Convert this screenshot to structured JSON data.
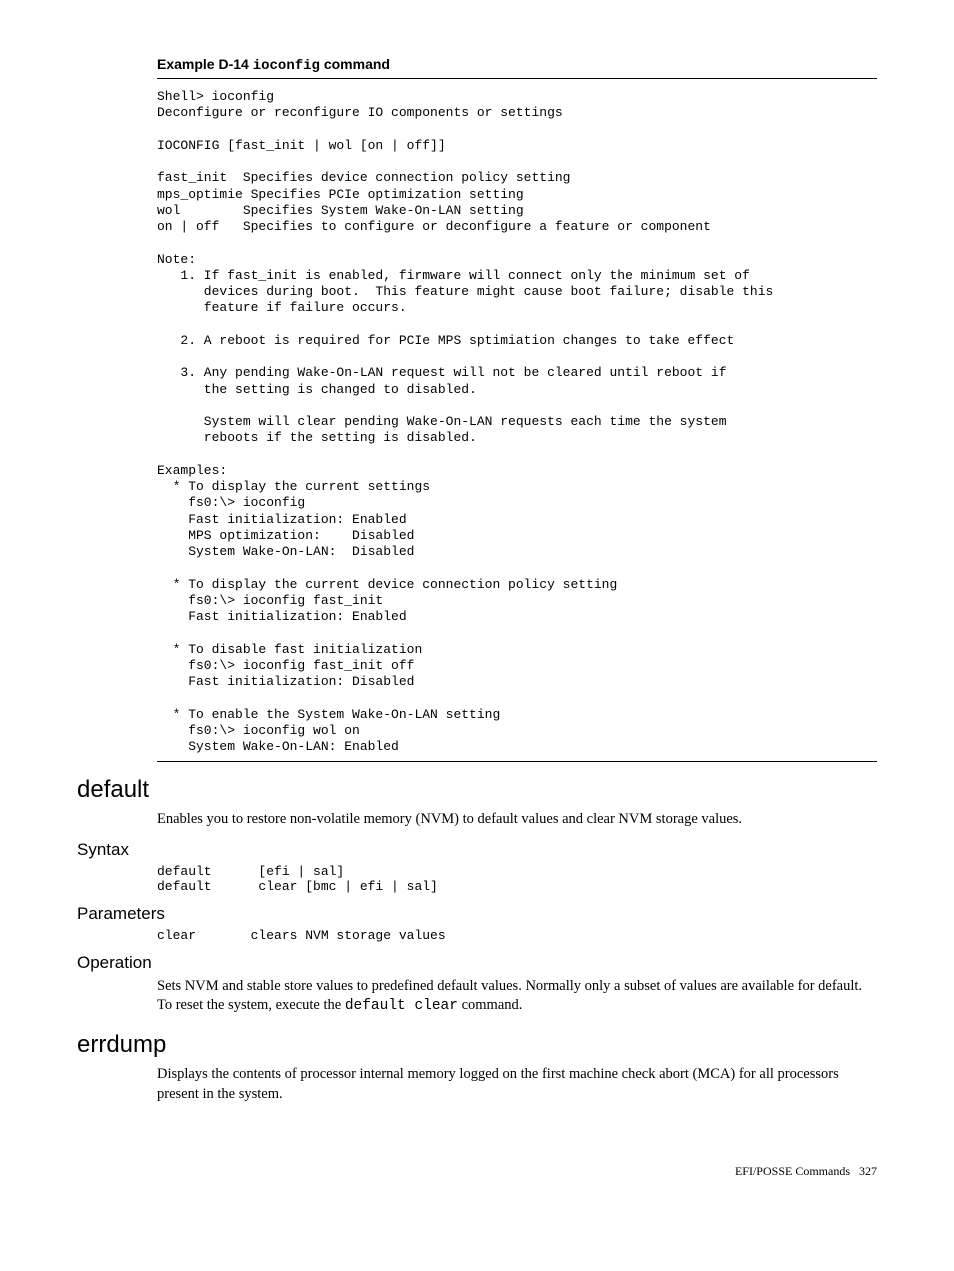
{
  "example": {
    "label_prefix": "Example D-14",
    "label_code": "ioconfig",
    "label_suffix": "command",
    "code": "Shell> ioconfig\nDeconfigure or reconfigure IO components or settings\n\nIOCONFIG [fast_init | wol [on | off]]\n\nfast_init  Specifies device connection policy setting\nmps_optimie Specifies PCIe optimization setting\nwol        Specifies System Wake-On-LAN setting\non | off   Specifies to configure or deconfigure a feature or component\n\nNote:\n   1. If fast_init is enabled, firmware will connect only the minimum set of\n      devices during boot.  This feature might cause boot failure; disable this\n      feature if failure occurs.\n\n   2. A reboot is required for PCIe MPS sptimiation changes to take effect\n\n   3. Any pending Wake-On-LAN request will not be cleared until reboot if\n      the setting is changed to disabled.\n\n      System will clear pending Wake-On-LAN requests each time the system\n      reboots if the setting is disabled.\n\nExamples:\n  * To display the current settings\n    fs0:\\> ioconfig\n    Fast initialization: Enabled\n    MPS optimization:    Disabled\n    System Wake-On-LAN:  Disabled\n\n  * To display the current device connection policy setting\n    fs0:\\> ioconfig fast_init\n    Fast initialization: Enabled\n\n  * To disable fast initialization\n    fs0:\\> ioconfig fast_init off\n    Fast initialization: Disabled\n\n  * To enable the System Wake-On-LAN setting\n    fs0:\\> ioconfig wol on\n    System Wake-On-LAN: Enabled"
  },
  "sections": {
    "default": {
      "heading": "default",
      "intro": "Enables you to restore non-volatile memory (NVM) to default values and clear NVM storage values.",
      "syntax_heading": "Syntax",
      "syntax_code": "default      [efi | sal]\ndefault      clear [bmc | efi | sal]",
      "parameters_heading": "Parameters",
      "parameters_code": "clear       clears NVM storage values",
      "operation_heading": "Operation",
      "operation_text_1": "Sets NVM and stable store values to predefined default values. Normally only a subset of values are available for default. To reset the system, execute the ",
      "operation_code": "default clear",
      "operation_text_2": " command."
    },
    "errdump": {
      "heading": "errdump",
      "intro": "Displays the contents of processor internal memory logged on the first machine check abort (MCA) for all processors present in the system."
    }
  },
  "footer": {
    "label": "EFI/POSSE Commands",
    "page": "327"
  }
}
